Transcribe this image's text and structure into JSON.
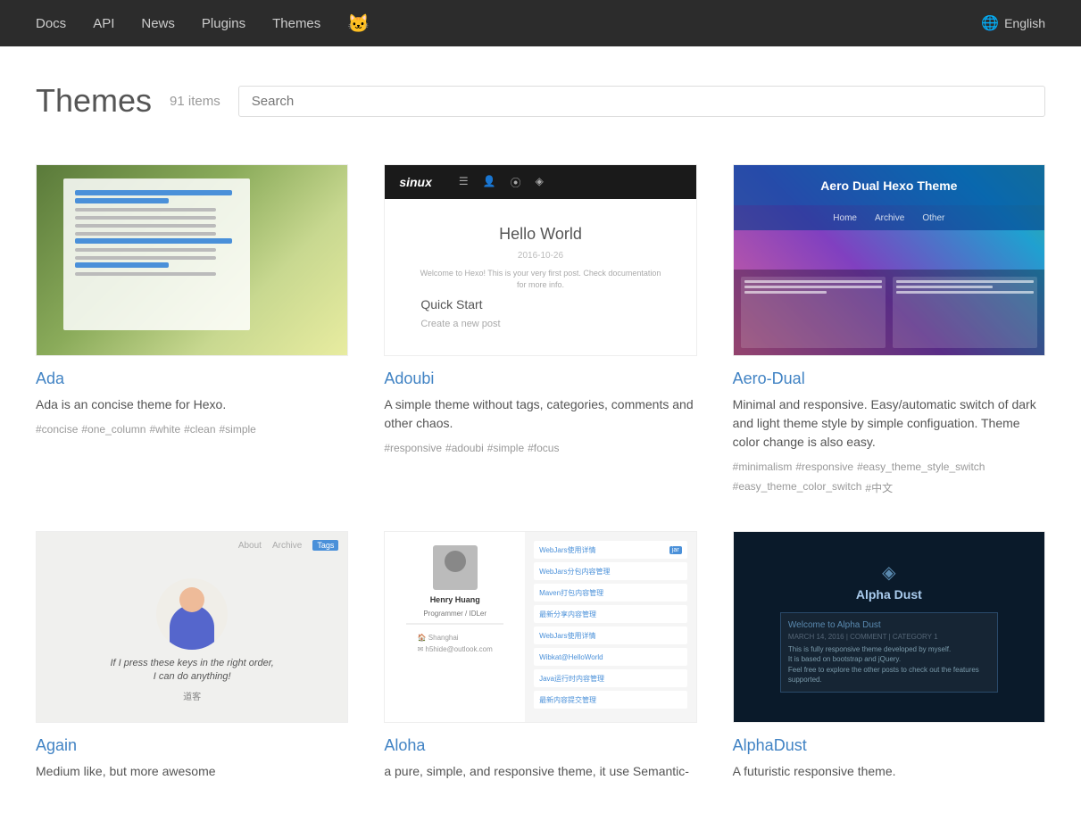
{
  "nav": {
    "links": [
      {
        "label": "Docs",
        "id": "docs"
      },
      {
        "label": "API",
        "id": "api"
      },
      {
        "label": "News",
        "id": "news"
      },
      {
        "label": "Plugins",
        "id": "plugins"
      },
      {
        "label": "Themes",
        "id": "themes"
      }
    ],
    "cat_icon": "🐱",
    "lang_label": "English"
  },
  "page": {
    "title": "Themes",
    "item_count": "91 items",
    "search_placeholder": "Search"
  },
  "themes": [
    {
      "id": "ada",
      "name": "Ada",
      "description": "Ada is an concise theme for Hexo.",
      "tags": [
        "#concise",
        "#one_column",
        "#white",
        "#clean",
        "#simple"
      ],
      "thumbnail": "ada"
    },
    {
      "id": "adoubi",
      "name": "Adoubi",
      "description": "A simple theme without tags, categories, comments and other chaos.",
      "tags": [
        "#responsive",
        "#adoubi",
        "#simple",
        "#focus"
      ],
      "thumbnail": "adoubi"
    },
    {
      "id": "aero-dual",
      "name": "Aero-Dual",
      "description": "Minimal and responsive. Easy/automatic switch of dark and light theme style by simple configuation. Theme color change is also easy.",
      "tags": [
        "#minimalism",
        "#responsive",
        "#easy_theme_style_switch",
        "#easy_theme_color_switch",
        "#中文"
      ],
      "thumbnail": "aero"
    },
    {
      "id": "again",
      "name": "Again",
      "description": "Medium like, but more awesome",
      "tags": [],
      "thumbnail": "again"
    },
    {
      "id": "aloha",
      "name": "Aloha",
      "description": "a pure, simple, and responsive theme, it use Semantic-",
      "tags": [],
      "thumbnail": "aloha"
    },
    {
      "id": "alphadust",
      "name": "AlphaDust",
      "description": "A futuristic responsive theme.",
      "tags": [],
      "thumbnail": "alphadust"
    }
  ]
}
